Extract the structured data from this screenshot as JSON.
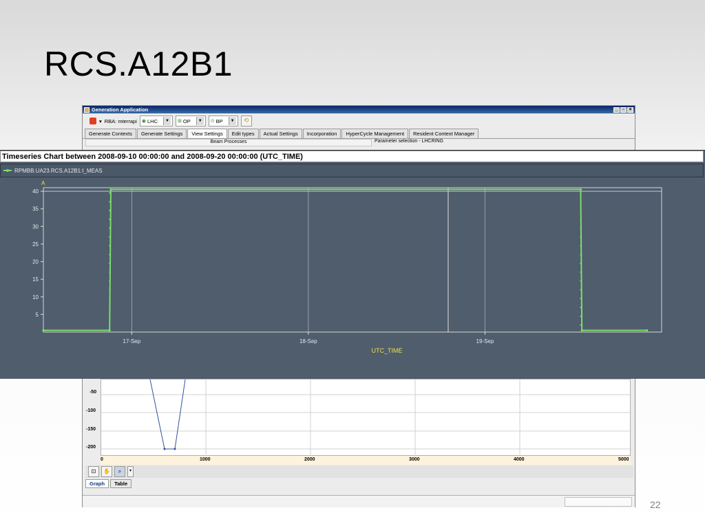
{
  "slide": {
    "title": "RCS.A12B1",
    "page_number": "22"
  },
  "app_window": {
    "title": "Generation Application",
    "window_buttons": [
      "_",
      "▫",
      "×"
    ],
    "toolbar": {
      "rba_label": "RBA: mterrapi",
      "machine_value": "LHC",
      "mode_value": "OP",
      "process_value": "BP"
    },
    "tabs": [
      {
        "label": "Generate Contexts"
      },
      {
        "label": "Generate Settings"
      },
      {
        "label": "View Settings"
      },
      {
        "label": "Edit types"
      },
      {
        "label": "Actual Settings"
      },
      {
        "label": "Incorporation"
      },
      {
        "label": "HyperCycle Management"
      },
      {
        "label": "Resident Context Manager"
      }
    ],
    "active_tab": "View Settings",
    "beam_processes_header": "Beam Processes",
    "parameter_selection_header": "Parameter selection - LHCRING",
    "lower_plot": {
      "y_ticks": [
        "-50",
        "-100",
        "-150",
        "-200"
      ],
      "x_ticks": [
        "0",
        "1000",
        "2000",
        "3000",
        "4000",
        "5000"
      ]
    },
    "bottom_tabs": [
      {
        "label": "Graph"
      },
      {
        "label": "Table"
      }
    ],
    "active_bottom_tab": "Graph"
  },
  "timeseries": {
    "title": "Timeseries Chart between 2008-09-10 00:00:00 and 2008-09-20 00:00:00 (UTC_TIME)",
    "legend_label": "RPMBB.UA23.RCS.A12B1:I_MEAS",
    "line_color": "#7ddc6c",
    "background_color": "#4f5d6d"
  },
  "chart_data": {
    "type": "line",
    "title": "Timeseries Chart between 2008-09-10 00:00:00 and 2008-09-20 00:00:00 (UTC_TIME)",
    "xlabel": "UTC_TIME",
    "ylabel": "A",
    "x_ticks": [
      "17-Sep",
      "18-Sep",
      "19-Sep"
    ],
    "y_ticks": [
      5,
      10,
      15,
      20,
      25,
      30,
      35,
      40
    ],
    "ylim": [
      0,
      41
    ],
    "xlim_days_label": [
      "2008-09-16 12:00",
      "2008-09-20 00:00"
    ],
    "series": [
      {
        "name": "RPMBB.UA23.RCS.A12B1:I_MEAS",
        "x": [
          "2008-09-16 12:00",
          "2008-09-16 21:00",
          "2008-09-16 21:10",
          "2008-09-19 13:00",
          "2008-09-19 13:10",
          "2008-09-19 22:00"
        ],
        "y": [
          0.5,
          0.5,
          40.5,
          40.5,
          0.5,
          0.5
        ]
      }
    ],
    "grid": true,
    "legend_position": "top-left"
  }
}
